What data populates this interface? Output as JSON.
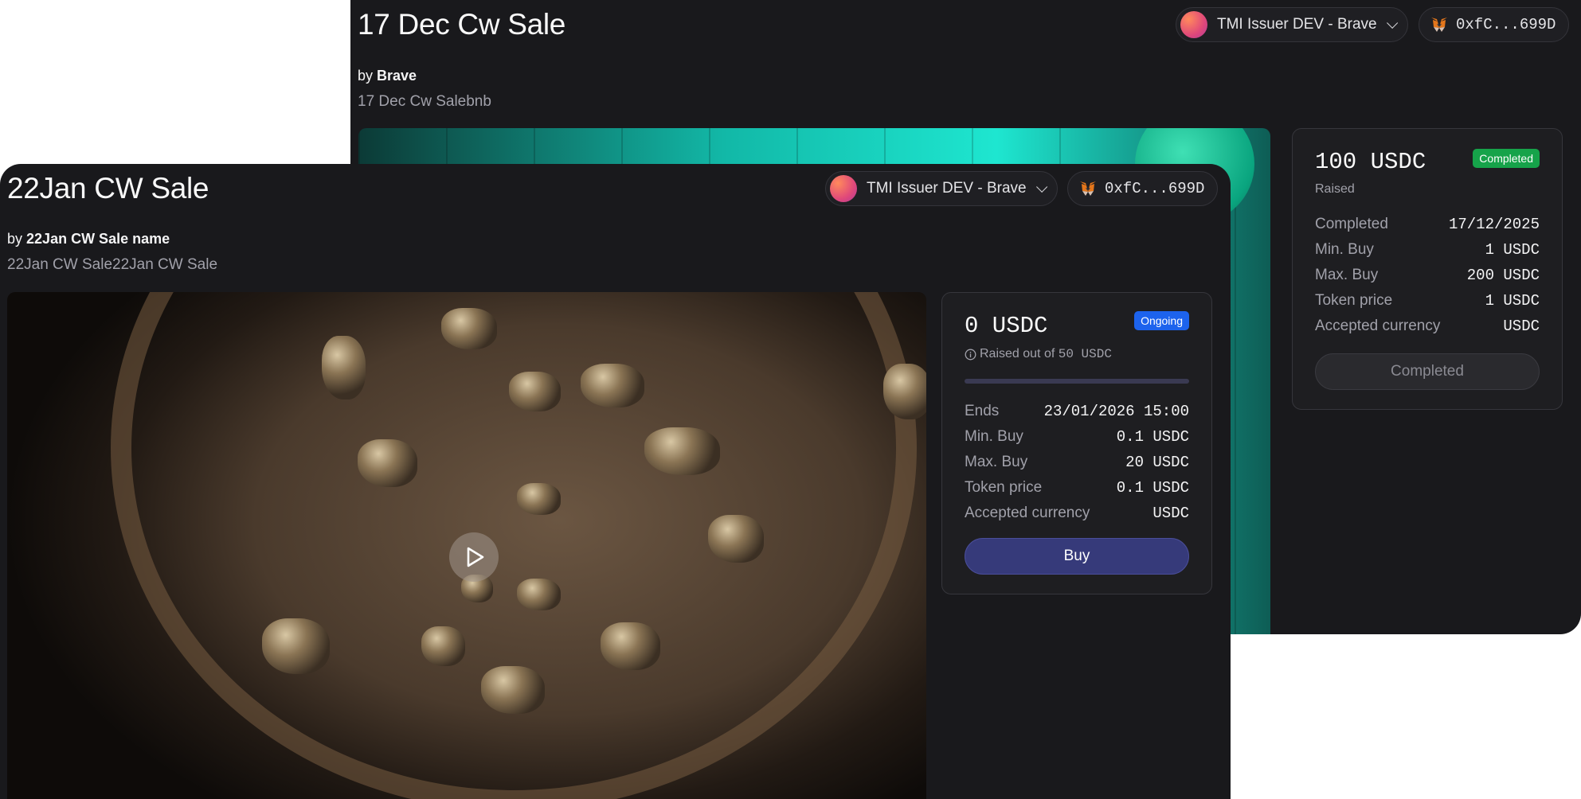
{
  "back": {
    "title": "17 Dec Cw Sale",
    "by_prefix": "by",
    "by_name": "Brave",
    "description": "17 Dec Cw Salebnb",
    "account_label": "TMI Issuer DEV - Brave",
    "wallet_address": "0xfC...699D",
    "card": {
      "amount": "100 USDC",
      "status_badge": "Completed",
      "raised_label": "Raised",
      "rows": [
        {
          "key": "Completed",
          "value": "17/12/2025"
        },
        {
          "key": "Min. Buy",
          "value": "1 USDC"
        },
        {
          "key": "Max. Buy",
          "value": "200 USDC"
        },
        {
          "key": "Token price",
          "value": "1 USDC"
        },
        {
          "key": "Accepted currency",
          "value": "USDC"
        }
      ],
      "button_label": "Completed"
    }
  },
  "front": {
    "title": "22Jan CW Sale",
    "by_prefix": "by",
    "by_name": "22Jan CW Sale name",
    "description": "22Jan CW Sale22Jan CW Sale",
    "account_label": "TMI Issuer DEV - Brave",
    "wallet_address": "0xfC...699D",
    "card": {
      "amount": "0 USDC",
      "status_badge": "Ongoing",
      "raised_prefix": "Raised out of",
      "raised_target": "50 USDC",
      "progress": 0.0,
      "rows": [
        {
          "key": "Ends",
          "value": "23/01/2026 15:00"
        },
        {
          "key": "Min. Buy",
          "value": "0.1 USDC"
        },
        {
          "key": "Max. Buy",
          "value": "20 USDC"
        },
        {
          "key": "Token price",
          "value": "0.1 USDC"
        },
        {
          "key": "Accepted currency",
          "value": "USDC"
        }
      ],
      "button_label": "Buy"
    }
  },
  "icons": {
    "avatar": "gradient-avatar",
    "wallet": "metamask-fox-icon",
    "dropdown": "chevron-down-icon",
    "info": "info-icon",
    "play": "play-icon"
  },
  "colors": {
    "badge_completed": "#16a34a",
    "badge_ongoing": "#1d63ed",
    "buy_button": "#363a7a"
  }
}
